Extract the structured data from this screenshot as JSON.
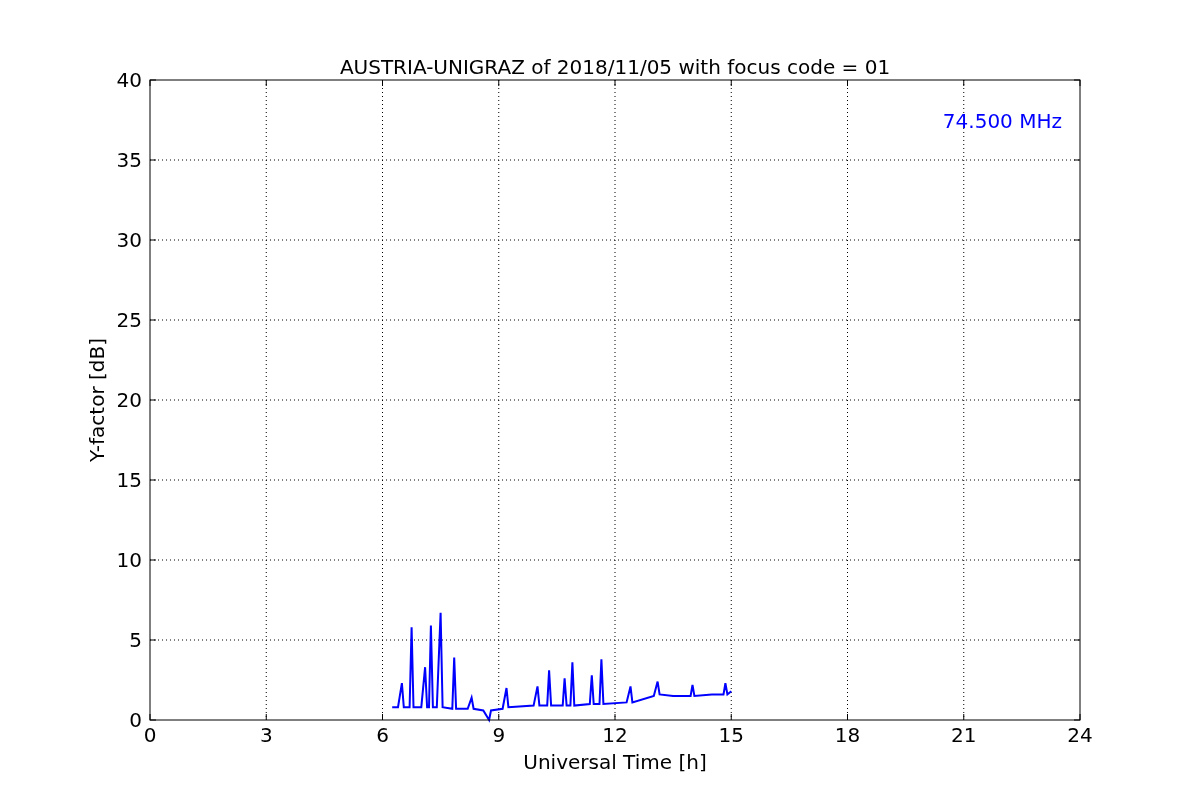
{
  "chart_data": {
    "type": "line",
    "title": "AUSTRIA-UNIGRAZ of 2018/11/05 with focus code = 01",
    "xlabel": "Universal Time [h]",
    "ylabel": "Y-factor [dB]",
    "x": [
      6.25,
      6.4,
      6.5,
      6.55,
      6.7,
      6.75,
      6.8,
      7.0,
      7.1,
      7.15,
      7.2,
      7.25,
      7.3,
      7.4,
      7.5,
      7.55,
      7.8,
      7.85,
      7.9,
      8.2,
      8.3,
      8.35,
      8.6,
      8.75,
      8.8,
      9.1,
      9.2,
      9.25,
      9.9,
      10.0,
      10.05,
      10.25,
      10.3,
      10.35,
      10.65,
      10.7,
      10.75,
      10.85,
      10.9,
      10.95,
      11.35,
      11.4,
      11.45,
      11.6,
      11.65,
      11.7,
      12.3,
      12.4,
      12.45,
      13.0,
      13.1,
      13.15,
      13.5,
      13.95,
      14.0,
      14.05,
      14.5,
      14.8,
      14.85,
      14.9,
      15.0
    ],
    "series": [
      {
        "color": "#0000ff",
        "values": [
          0.8,
          0.8,
          2.3,
          0.8,
          0.8,
          5.8,
          0.8,
          0.8,
          3.3,
          0.8,
          0.8,
          5.9,
          0.8,
          0.8,
          6.7,
          0.8,
          0.7,
          3.9,
          0.7,
          0.7,
          1.4,
          0.7,
          0.6,
          0.0,
          0.6,
          0.7,
          2.0,
          0.8,
          0.9,
          2.1,
          0.9,
          0.9,
          3.1,
          0.9,
          0.9,
          2.6,
          0.9,
          0.9,
          3.6,
          0.9,
          1.0,
          2.8,
          1.0,
          1.0,
          3.8,
          1.0,
          1.1,
          2.1,
          1.1,
          1.5,
          2.4,
          1.6,
          1.5,
          1.5,
          2.2,
          1.5,
          1.6,
          1.6,
          2.3,
          1.6,
          1.8
        ]
      }
    ],
    "xlim": [
      0,
      24
    ],
    "ylim": [
      0,
      40
    ],
    "xticks": [
      0,
      3,
      6,
      9,
      12,
      15,
      18,
      21,
      24
    ],
    "yticks": [
      0,
      5,
      10,
      15,
      20,
      25,
      30,
      35,
      40
    ],
    "grid": true,
    "annotations": [
      {
        "text": "74.500 MHz"
      }
    ]
  }
}
